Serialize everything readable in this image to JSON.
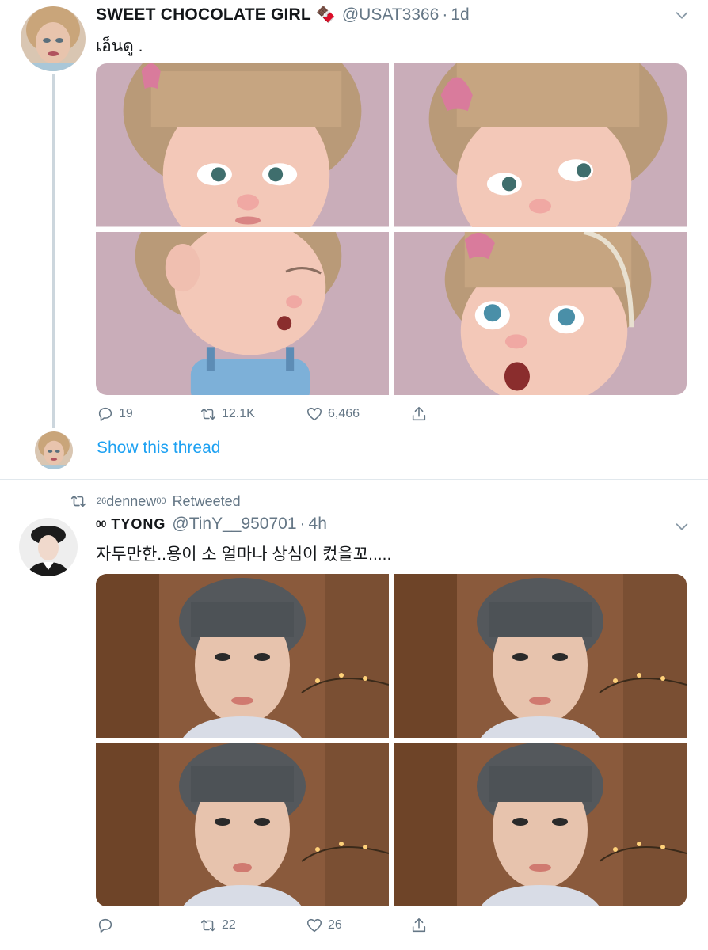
{
  "tweet1": {
    "display_name": "SWEET CHOCOLATE GIRL",
    "name_emoji": "🍫",
    "handle": "@USAT3366",
    "separator": "·",
    "time": "1d",
    "text": "เอ็นดู .",
    "replies": "19",
    "retweets": "12.1K",
    "likes": "6,466",
    "show_thread": "Show this thread"
  },
  "retweet_header": {
    "sup_prefix": "26",
    "name": "dennew",
    "sup_suffix": "00",
    "label": "Retweeted"
  },
  "tweet2": {
    "sup_prefix": "00",
    "display_name": "TYONG",
    "handle": "@TinY__950701",
    "separator": "·",
    "time": "4h",
    "text": "자두만한..용이 소 얼마나 상심이 컸을꼬.....",
    "replies": "",
    "retweets": "22",
    "likes": "26"
  },
  "colors": {
    "accent": "#1da1f2",
    "secondary_text": "#657786",
    "divider": "#e1e8ed",
    "thread_line": "#ccd6dd"
  },
  "icons": {
    "reply": "reply-icon",
    "retweet": "retweet-icon",
    "like": "heart-icon",
    "share": "share-icon",
    "caret": "chevron-down-icon"
  }
}
